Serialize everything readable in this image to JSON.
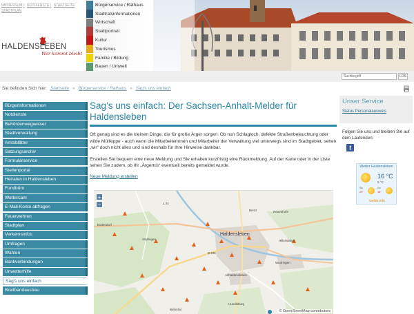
{
  "header": {
    "toplinks": [
      "IMPRESSUM",
      "NOTDIENSTE",
      "STARTSEITE",
      "STADTPLAN"
    ],
    "logo_text": "HALDENSLEBEN",
    "logo_tagline": "Wer kommt bleibt",
    "categories": [
      {
        "label": "Bürgerservice / Rathaus",
        "color": "#3f7e99"
      },
      {
        "label": "Stadtratsinformationen",
        "color": "#2b5575"
      },
      {
        "label": "Wirtschaft",
        "color": "#7d7d7d"
      },
      {
        "label": "Stadtportrait",
        "color": "#b43b3b"
      },
      {
        "label": "Kultur",
        "color": "#c41818"
      },
      {
        "label": "Tourismus",
        "color": "#e8a91c"
      },
      {
        "label": "Familie / Bildung",
        "color": "#f1d300"
      },
      {
        "label": "Bauen / Umwelt",
        "color": "#5b9a6c"
      }
    ]
  },
  "search": {
    "placeholder": "Suchbegriff",
    "button": "LOS"
  },
  "breadcrumb": {
    "prefix": "Sie befinden Sich hier:",
    "items": [
      "Startseite",
      "Bürgerservice / Rathaus",
      "Sag's uns einfach"
    ]
  },
  "sidebar": {
    "items": [
      {
        "label": "Bürgerinformationen",
        "active": false
      },
      {
        "label": "Notdienste",
        "active": false
      },
      {
        "label": "Behördenwegweiser",
        "active": false
      },
      {
        "label": "Stadtverwaltung",
        "active": false
      },
      {
        "label": "Amtsblätter",
        "active": false
      },
      {
        "label": "Satzungsarchiv",
        "active": false
      },
      {
        "label": "Formularservice",
        "active": false
      },
      {
        "label": "Stellenportal",
        "active": false
      },
      {
        "label": "Heiraten in Haldensleben",
        "active": false
      },
      {
        "label": "Fundbüro",
        "active": false
      },
      {
        "label": "Wettercam",
        "active": false
      },
      {
        "label": "E-Mail-Konto abfragen",
        "active": false
      },
      {
        "label": "Feuerwehren",
        "active": false
      },
      {
        "label": "Stadtplan",
        "active": false
      },
      {
        "label": "Verkehrsinfos",
        "active": false
      },
      {
        "label": "Umfragen",
        "active": false
      },
      {
        "label": "Wahlen",
        "active": false
      },
      {
        "label": "Bankverbindungen",
        "active": false
      },
      {
        "label": "Unwetterhilfe",
        "active": false
      },
      {
        "label": "Sag's uns einfach",
        "active": true
      },
      {
        "label": "Breitbandausbau",
        "active": false
      }
    ]
  },
  "main": {
    "title": "Sag’s uns einfach: Der Sachsen-Anhalt-Melder für Haldensleben",
    "para1": "Oft genug sind es die kleinen Dinge, die für große Ärger sorgen: Ob nun Schlagloch, defekte Straßenbeleuchtung oder wilde Müllkippe - auch wenn die Mitarbeiterinnen und Mitarbeiter der Verwaltung viel unterwegs sind im Stadtgebiet, sehen „wir“ doch nicht alles und sind deshalb für Ihre Hinweise dankbar.",
    "para2": "Erstellen Sie bequem eine neue Meldung  und Sie erhalten kurzfristig eine Rückmeldung. Auf der Karte oder in der Liste sehen Sie zudem, ob Ihr „Ärgernis“ eventuell bereits gemeldet wurde.",
    "new_report_link": "Neue Meldung erstellen"
  },
  "map": {
    "zoom_in": "+",
    "zoom_out": "−",
    "attribution": "© OpenStreetMap contributors",
    "towns": {
      "haldensleben": "Haldensleben",
      "suplingen": "Süplingen",
      "bodendorf": "Bodendorf",
      "bentz": "Bentz",
      "neuenhofe": "Neuenhofe",
      "hillersleben": "Hillersleben",
      "wedringen": "Wedringen",
      "althaldensleben": "Althaldensleben",
      "hundisburg": "Hundisburg",
      "bebertal": "Bebertal",
      "l24": "L 24",
      "b245": "B 245"
    }
  },
  "right": {
    "service_title": "Unser Service",
    "service_link": "Status Personalausweis",
    "follow_text": "Folgen Sie uns und bleiben Sie auf dem Laufenden:",
    "fb_glyph": "f",
    "weather": {
      "title": "Wetter Haldensleben",
      "temp": "16 °C",
      "sub": "5 °C",
      "day1": "Sa",
      "day1_hi": "20°",
      "day2": "So",
      "day2_hi": "18°",
      "brand": "wetter.info"
    }
  }
}
